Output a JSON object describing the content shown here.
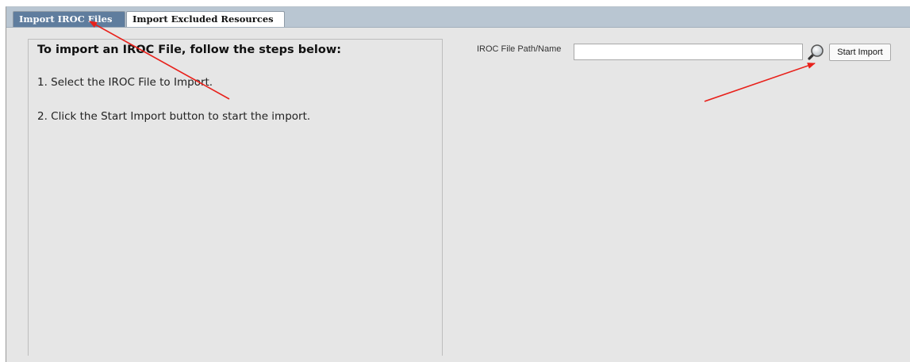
{
  "tabs": [
    {
      "label": "Import IROC Files",
      "active": true
    },
    {
      "label": "Import Excluded Resources",
      "active": false
    }
  ],
  "instructions": {
    "title": "To import an IROC File, follow the steps below:",
    "steps": [
      "1. Select the IROC File to Import.",
      "2. Click the Start Import button to start the import."
    ]
  },
  "import_form": {
    "path_label": "IROC File Path/Name",
    "path_value": "",
    "path_placeholder": "",
    "start_button_label": "Start Import"
  },
  "icons": {
    "browse": "magnifier-icon"
  },
  "colors": {
    "tab_strip": "#b9c6d2",
    "active_tab": "#5f7d9e",
    "panel_background": "#e6e6e6",
    "annotation_arrow": "#e8211b"
  }
}
